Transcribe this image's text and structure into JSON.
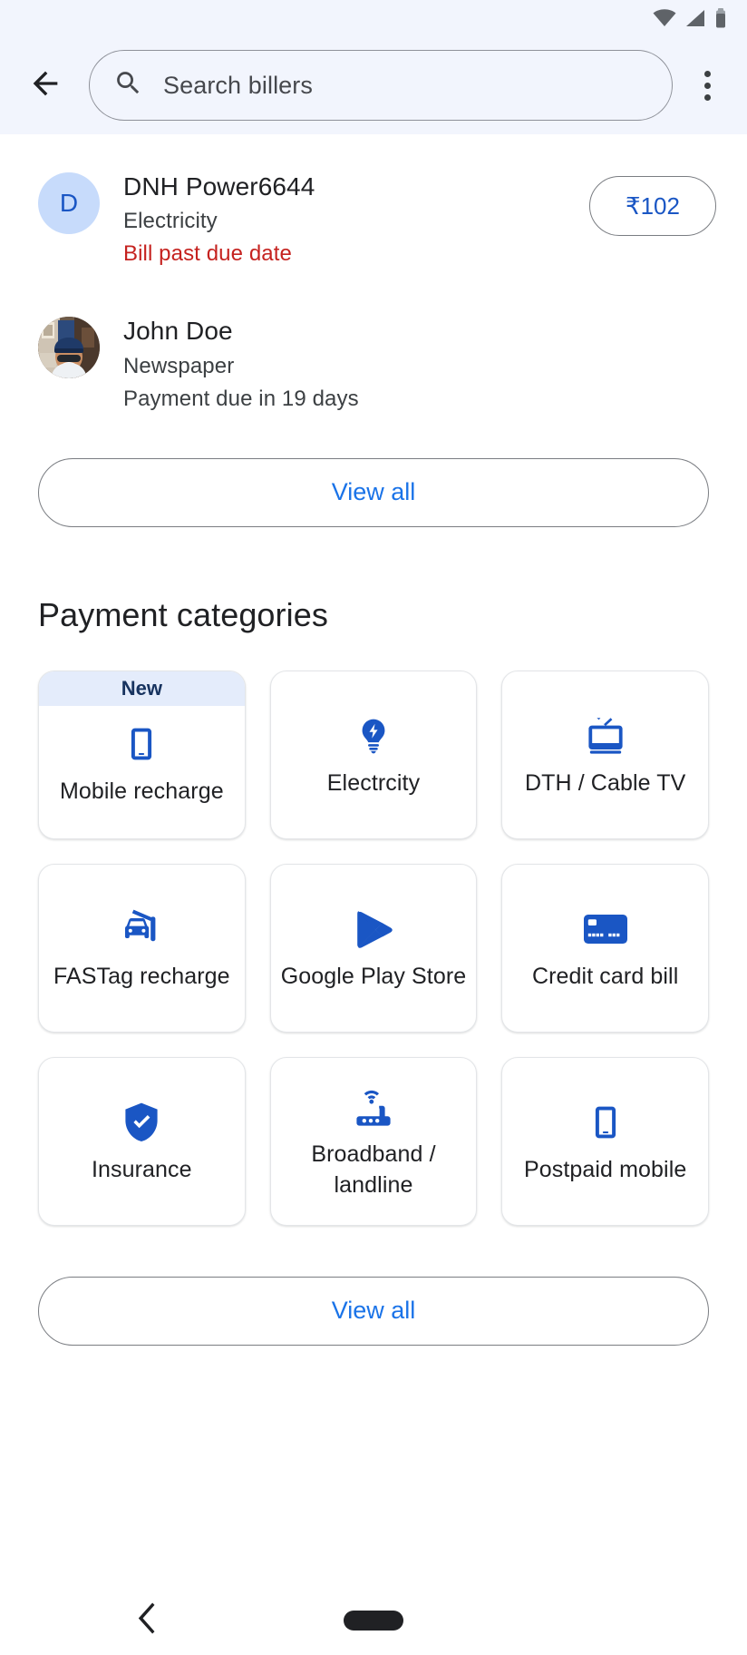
{
  "statusbar": {
    "icons": [
      "wifi-icon",
      "cellular-signal-icon",
      "battery-icon"
    ]
  },
  "header": {
    "back_icon": "arrow-back-icon",
    "search_placeholder": "Search billers",
    "search_icon": "search-icon",
    "overflow_icon": "more-vert-icon"
  },
  "billers": [
    {
      "avatar_type": "letter",
      "avatar_letter": "D",
      "name": "DNH Power6644",
      "category": "Electricity",
      "status": "Bill past due date",
      "status_kind": "overdue",
      "amount": "₹102"
    },
    {
      "avatar_type": "photo",
      "avatar_letter": "",
      "name": "John Doe",
      "category": "Newspaper",
      "status": "Payment due in 19 days",
      "status_kind": "normal",
      "amount": ""
    }
  ],
  "billers_view_all": "View all",
  "categories_section": {
    "title": "Payment categories",
    "view_all": "View all",
    "tiles": [
      {
        "label": "Mobile recharge",
        "icon": "smartphone-icon",
        "badge": "New"
      },
      {
        "label": "Electrcity",
        "icon": "lightbulb-bolt-icon",
        "badge": ""
      },
      {
        "label": "DTH / Cable TV",
        "icon": "tv-icon",
        "badge": ""
      },
      {
        "label": "FASTag recharge",
        "icon": "toll-car-icon",
        "badge": ""
      },
      {
        "label": "Google Play Store",
        "icon": "google-play-icon",
        "badge": ""
      },
      {
        "label": "Credit card bill",
        "icon": "credit-card-icon",
        "badge": ""
      },
      {
        "label": "Insurance",
        "icon": "shield-check-icon",
        "badge": ""
      },
      {
        "label": "Broadband / landline",
        "icon": "router-wifi-icon",
        "badge": ""
      },
      {
        "label": "Postpaid mobile",
        "icon": "smartphone-icon",
        "badge": ""
      }
    ]
  },
  "navbar": {
    "back_icon": "nav-back-chevron-icon",
    "home_icon": "nav-home-pill-icon"
  },
  "colors": {
    "accent_blue": "#1a73e8",
    "icon_blue": "#1a56c4",
    "error_red": "#c5221f",
    "header_bg": "#f2f5fd",
    "badge_bg": "#e4ecfb"
  }
}
